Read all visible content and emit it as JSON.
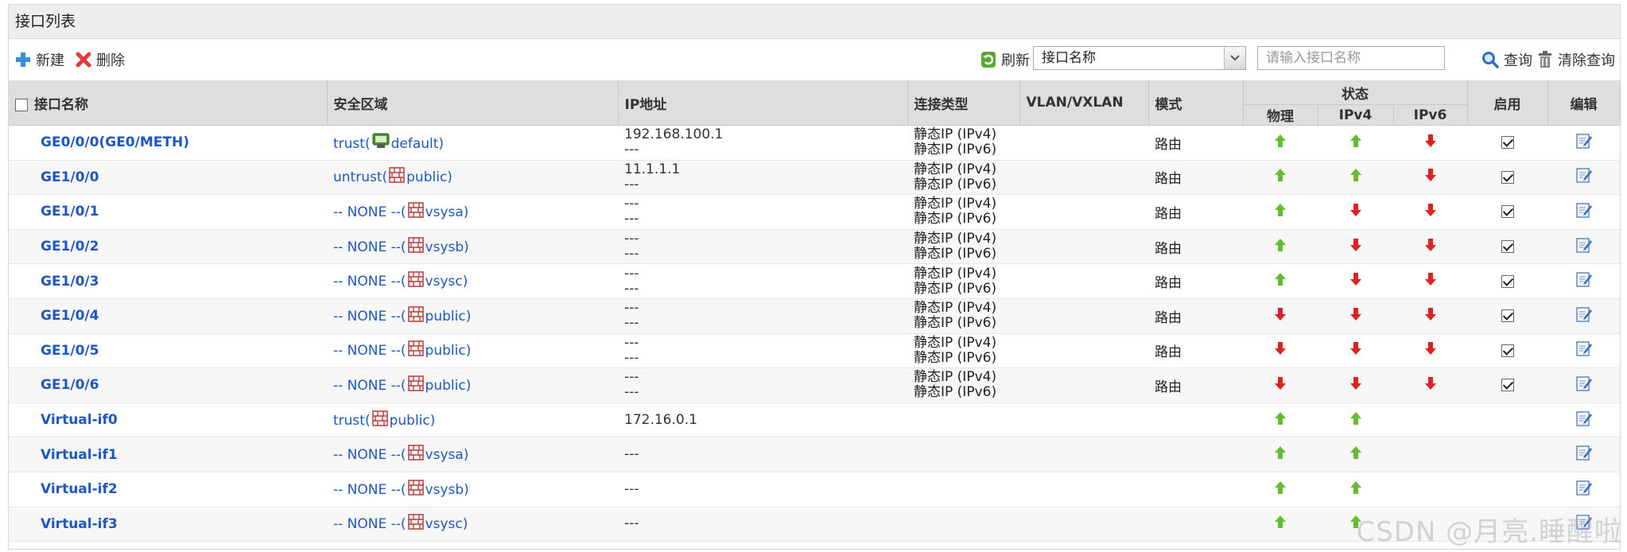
{
  "panel": {
    "title": "接口列表"
  },
  "toolbar": {
    "new_label": "新建",
    "delete_label": "删除",
    "refresh_label": "刷新",
    "search_field_value": "接口名称",
    "search_placeholder": "请输入接口名称",
    "query_label": "查询",
    "clear_label": "清除查询"
  },
  "table": {
    "headers": {
      "name": "接口名称",
      "zone": "安全区域",
      "ip": "IP地址",
      "conn": "连接类型",
      "vlan": "VLAN/VXLAN",
      "mode": "模式",
      "status": "状态",
      "physical": "物理",
      "ipv4": "IPv4",
      "ipv6": "IPv6",
      "enable": "启用",
      "edit": "编辑"
    },
    "rows": [
      {
        "name": "GE0/0/0(GE0/METH)",
        "zone_prefix": "trust(",
        "zone_icon": "green-monitor-icon",
        "zone_name": "default)",
        "ip1": "192.168.100.1",
        "ip2": "---",
        "conn1": "静态IP (IPv4)",
        "conn2": "静态IP (IPv6)",
        "mode": "路由",
        "phys": "up",
        "ipv4": "up",
        "ipv6": "down",
        "enabled": true
      },
      {
        "name": "GE1/0/0",
        "zone_prefix": "untrust(",
        "zone_icon": "firewall-brick-icon",
        "zone_name": "public)",
        "ip1": "11.1.1.1",
        "ip2": "---",
        "conn1": "静态IP (IPv4)",
        "conn2": "静态IP (IPv6)",
        "mode": "路由",
        "phys": "up",
        "ipv4": "up",
        "ipv6": "down",
        "enabled": true
      },
      {
        "name": "GE1/0/1",
        "zone_prefix": "-- NONE --(",
        "zone_icon": "firewall-brick-icon",
        "zone_name": "vsysa)",
        "ip1": "---",
        "ip2": "---",
        "conn1": "静态IP (IPv4)",
        "conn2": "静态IP (IPv6)",
        "mode": "路由",
        "phys": "up",
        "ipv4": "down",
        "ipv6": "down",
        "enabled": true
      },
      {
        "name": "GE1/0/2",
        "zone_prefix": "-- NONE --(",
        "zone_icon": "firewall-brick-icon",
        "zone_name": "vsysb)",
        "ip1": "---",
        "ip2": "---",
        "conn1": "静态IP (IPv4)",
        "conn2": "静态IP (IPv6)",
        "mode": "路由",
        "phys": "up",
        "ipv4": "down",
        "ipv6": "down",
        "enabled": true
      },
      {
        "name": "GE1/0/3",
        "zone_prefix": "-- NONE --(",
        "zone_icon": "firewall-brick-icon",
        "zone_name": "vsysc)",
        "ip1": "---",
        "ip2": "---",
        "conn1": "静态IP (IPv4)",
        "conn2": "静态IP (IPv6)",
        "mode": "路由",
        "phys": "up",
        "ipv4": "down",
        "ipv6": "down",
        "enabled": true
      },
      {
        "name": "GE1/0/4",
        "zone_prefix": "-- NONE --(",
        "zone_icon": "firewall-brick-icon",
        "zone_name": "public)",
        "ip1": "---",
        "ip2": "---",
        "conn1": "静态IP (IPv4)",
        "conn2": "静态IP (IPv6)",
        "mode": "路由",
        "phys": "down",
        "ipv4": "down",
        "ipv6": "down",
        "enabled": true
      },
      {
        "name": "GE1/0/5",
        "zone_prefix": "-- NONE --(",
        "zone_icon": "firewall-brick-icon",
        "zone_name": "public)",
        "ip1": "---",
        "ip2": "---",
        "conn1": "静态IP (IPv4)",
        "conn2": "静态IP (IPv6)",
        "mode": "路由",
        "phys": "down",
        "ipv4": "down",
        "ipv6": "down",
        "enabled": true
      },
      {
        "name": "GE1/0/6",
        "zone_prefix": "-- NONE --(",
        "zone_icon": "firewall-brick-icon",
        "zone_name": "public)",
        "ip1": "---",
        "ip2": "---",
        "conn1": "静态IP (IPv4)",
        "conn2": "静态IP (IPv6)",
        "mode": "路由",
        "phys": "down",
        "ipv4": "down",
        "ipv6": "down",
        "enabled": true
      },
      {
        "name": "Virtual-if0",
        "zone_prefix": "trust(",
        "zone_icon": "firewall-brick-icon",
        "zone_name": "public)",
        "ip1": "172.16.0.1",
        "ip2": "",
        "conn1": "",
        "conn2": "",
        "mode": "",
        "phys": "up",
        "ipv4": "up",
        "ipv6": "",
        "enabled": null
      },
      {
        "name": "Virtual-if1",
        "zone_prefix": "-- NONE --(",
        "zone_icon": "firewall-brick-icon",
        "zone_name": "vsysa)",
        "ip1": "---",
        "ip2": "",
        "conn1": "",
        "conn2": "",
        "mode": "",
        "phys": "up",
        "ipv4": "up",
        "ipv6": "",
        "enabled": null
      },
      {
        "name": "Virtual-if2",
        "zone_prefix": "-- NONE --(",
        "zone_icon": "firewall-brick-icon",
        "zone_name": "vsysb)",
        "ip1": "---",
        "ip2": "",
        "conn1": "",
        "conn2": "",
        "mode": "",
        "phys": "up",
        "ipv4": "up",
        "ipv6": "",
        "enabled": null
      },
      {
        "name": "Virtual-if3",
        "zone_prefix": "-- NONE --(",
        "zone_icon": "firewall-brick-icon",
        "zone_name": "vsysc)",
        "ip1": "---",
        "ip2": "",
        "conn1": "",
        "conn2": "",
        "mode": "",
        "phys": "up",
        "ipv4": "up",
        "ipv6": "",
        "enabled": null
      }
    ]
  },
  "colors": {
    "up": "#66bb33",
    "down": "#dd2222",
    "link": "#1f56c5",
    "header_bg": "#dedede"
  },
  "watermark": "CSDN @月亮.睡醒啦"
}
